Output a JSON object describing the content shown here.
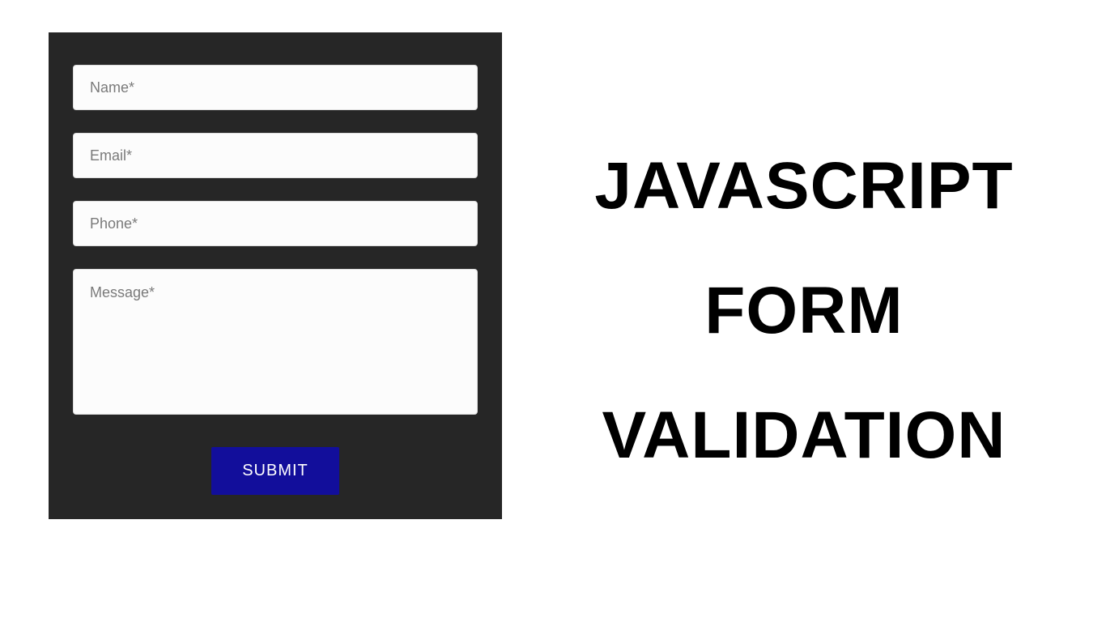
{
  "form": {
    "name_placeholder": "Name*",
    "email_placeholder": "Email*",
    "phone_placeholder": "Phone*",
    "message_placeholder": "Message*",
    "submit_label": "SUBMIT",
    "name_value": "",
    "email_value": "",
    "phone_value": "",
    "message_value": ""
  },
  "title": {
    "line1": "JAVASCRIPT",
    "line2": "FORM",
    "line3": "VALIDATION"
  },
  "colors": {
    "panel_bg": "#262626",
    "input_bg": "#fcfcfc",
    "button_bg": "#120e9b",
    "button_text": "#ffffff",
    "placeholder": "#7a7a7a"
  }
}
